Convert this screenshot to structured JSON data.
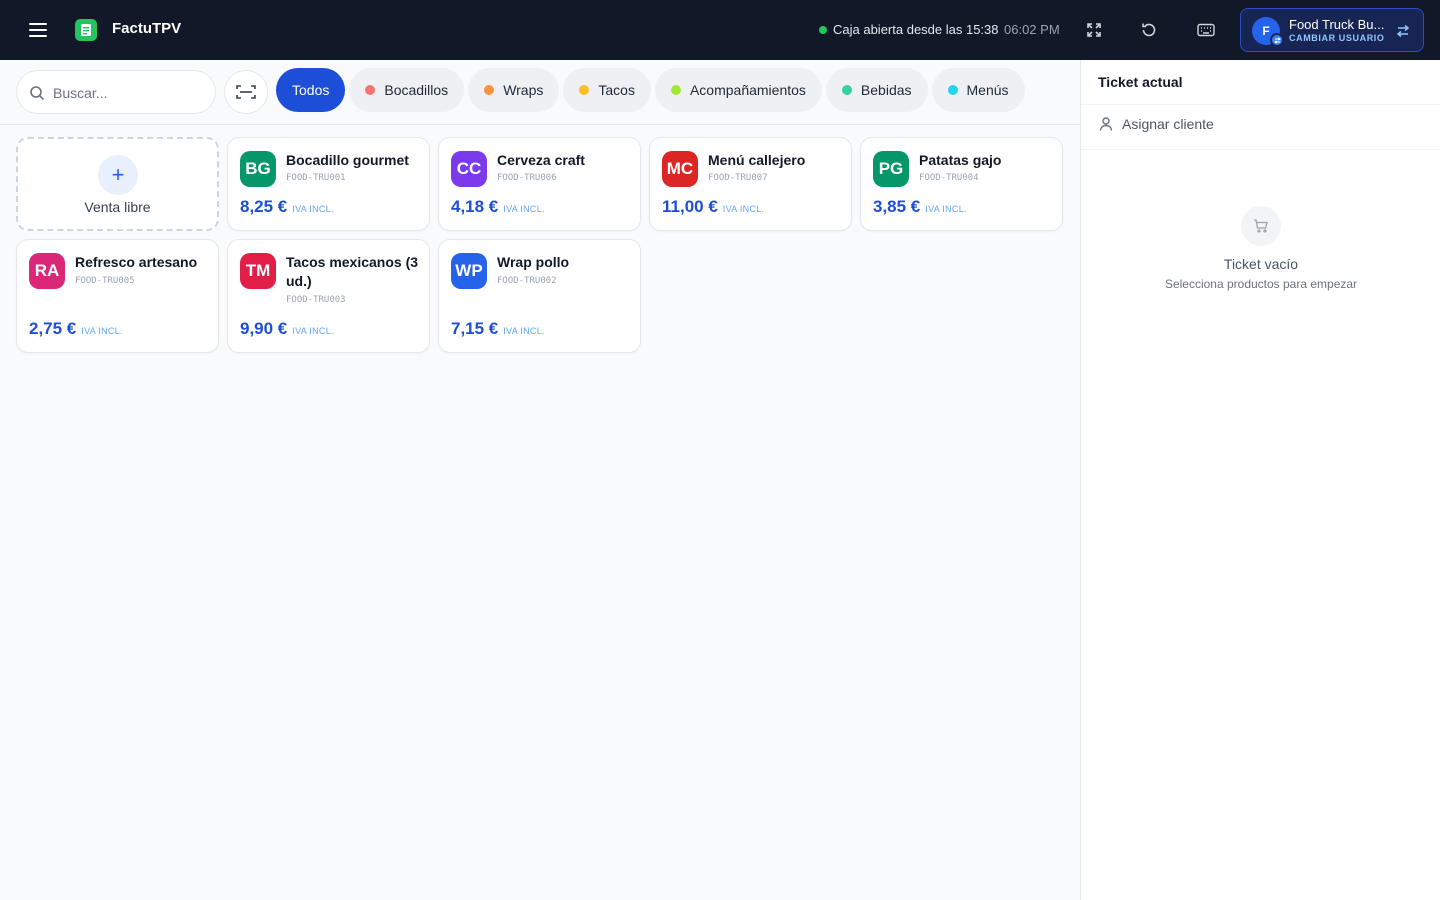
{
  "app": {
    "title": "FactuTPV"
  },
  "header": {
    "status_text": "Caja abierta desde las 15:38",
    "clock": "06:02 PM",
    "user": {
      "name": "Food Truck Bu...",
      "initial": "F",
      "switch_label": "CAMBIAR USUARIO"
    }
  },
  "search": {
    "placeholder": "Buscar..."
  },
  "categories": [
    {
      "label": "Todos",
      "color": ""
    },
    {
      "label": "Bocadillos",
      "color": "#f87171"
    },
    {
      "label": "Wraps",
      "color": "#fb923c"
    },
    {
      "label": "Tacos",
      "color": "#fbbf24"
    },
    {
      "label": "Acompañamientos",
      "color": "#a3e635"
    },
    {
      "label": "Bebidas",
      "color": "#34d399"
    },
    {
      "label": "Menús",
      "color": "#22d3ee"
    }
  ],
  "free_sale": {
    "label": "Venta libre"
  },
  "products": [
    {
      "initials": "BG",
      "name": "Bocadillo gourmet",
      "code": "FOOD-TRU001",
      "price": "8,25 €",
      "tax": "IVA INCL.",
      "color": "#059669"
    },
    {
      "initials": "CC",
      "name": "Cerveza craft",
      "code": "FOOD-TRU006",
      "price": "4,18 €",
      "tax": "IVA INCL.",
      "color": "#7c3aed"
    },
    {
      "initials": "MC",
      "name": "Menú callejero",
      "code": "FOOD-TRU007",
      "price": "11,00 €",
      "tax": "IVA INCL.",
      "color": "#dc2626"
    },
    {
      "initials": "PG",
      "name": "Patatas gajo",
      "code": "FOOD-TRU004",
      "price": "3,85 €",
      "tax": "IVA INCL.",
      "color": "#059669"
    },
    {
      "initials": "RA",
      "name": "Refresco artesano",
      "code": "FOOD-TRU005",
      "price": "2,75 €",
      "tax": "IVA INCL.",
      "color": "#db2777"
    },
    {
      "initials": "TM",
      "name": "Tacos mexicanos (3 ud.)",
      "code": "FOOD-TRU003",
      "price": "9,90 €",
      "tax": "IVA INCL.",
      "color": "#e11d48"
    },
    {
      "initials": "WP",
      "name": "Wrap pollo",
      "code": "FOOD-TRU002",
      "price": "7,15 €",
      "tax": "IVA INCL.",
      "color": "#2563eb"
    }
  ],
  "ticket": {
    "title": "Ticket actual",
    "assign_client": "Asignar cliente",
    "empty_title": "Ticket vacío",
    "empty_subtitle": "Selecciona productos para empezar"
  }
}
